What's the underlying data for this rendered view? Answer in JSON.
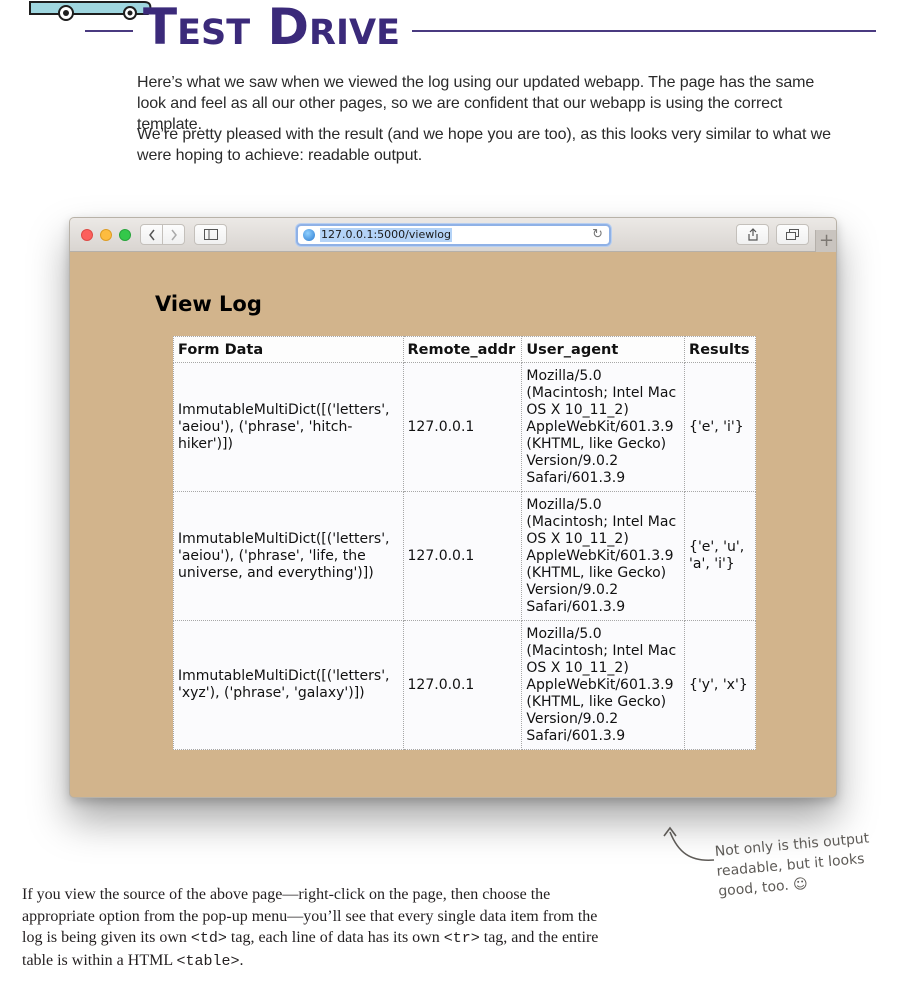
{
  "header": {
    "title": "Test Drive"
  },
  "intro": {
    "paragraph1": "Here’s what we saw when we viewed the log using our updated webapp. The page has the same look and feel as all our other pages, so we are confident that our webapp is using the correct template.",
    "paragraph2": "We’re pretty pleased with the result (and we hope you are too), as this looks very similar to what we were hoping to achieve: readable output."
  },
  "browser": {
    "url": "127.0.0.1:5000/viewlog",
    "page_heading": "View Log",
    "columns": [
      "Form Data",
      "Remote_addr",
      "User_agent",
      "Results"
    ],
    "rows": [
      {
        "form_data": "ImmutableMultiDict([('letters', 'aeiou'), ('phrase', 'hitch-hiker')])",
        "remote_addr": "127.0.0.1",
        "user_agent": "Mozilla/5.0 (Macintosh; Intel Mac OS X 10_11_2) AppleWebKit/601.3.9 (KHTML, like Gecko) Version/9.0.2 Safari/601.3.9",
        "results": "{'e', 'i'}"
      },
      {
        "form_data": "ImmutableMultiDict([('letters', 'aeiou'), ('phrase', 'life, the universe, and everything')])",
        "remote_addr": "127.0.0.1",
        "user_agent": "Mozilla/5.0 (Macintosh; Intel Mac OS X 10_11_2) AppleWebKit/601.3.9 (KHTML, like Gecko) Version/9.0.2 Safari/601.3.9",
        "results": "{'e', 'u', 'a', 'i'}"
      },
      {
        "form_data": "ImmutableMultiDict([('letters', 'xyz'), ('phrase', 'galaxy')])",
        "remote_addr": "127.0.0.1",
        "user_agent": "Mozilla/5.0 (Macintosh; Intel Mac OS X 10_11_2) AppleWebKit/601.3.9 (KHTML, like Gecko) Version/9.0.2 Safari/601.3.9",
        "results": "{'y', 'x'}"
      }
    ],
    "icons": {
      "back": "chevron-left-icon",
      "forward": "chevron-right-icon",
      "sidebar": "sidebar-icon",
      "share": "share-icon",
      "tabs": "tabs-icon",
      "new_tab": "plus-icon",
      "reload": "reload-icon",
      "site": "globe-icon"
    }
  },
  "annotation": {
    "text": "Not only is this output readable, but it looks good, too. ☺"
  },
  "footer": {
    "part1": "If you view the source of the above page—right-click on the page, then choose the appropriate option from the pop-up menu—you’ll see that every single data item from the log is being given its own ",
    "td_tag": "<td>",
    "part2": " tag, each line of data has its own ",
    "tr_tag": "<tr>",
    "part3": " tag, and the entire table is within a HTML ",
    "table_tag": "<table>",
    "part4": "."
  },
  "colors": {
    "title": "#3b2a7a",
    "page_background": "#d2b48c",
    "address_focus": "#8fb1e6"
  }
}
